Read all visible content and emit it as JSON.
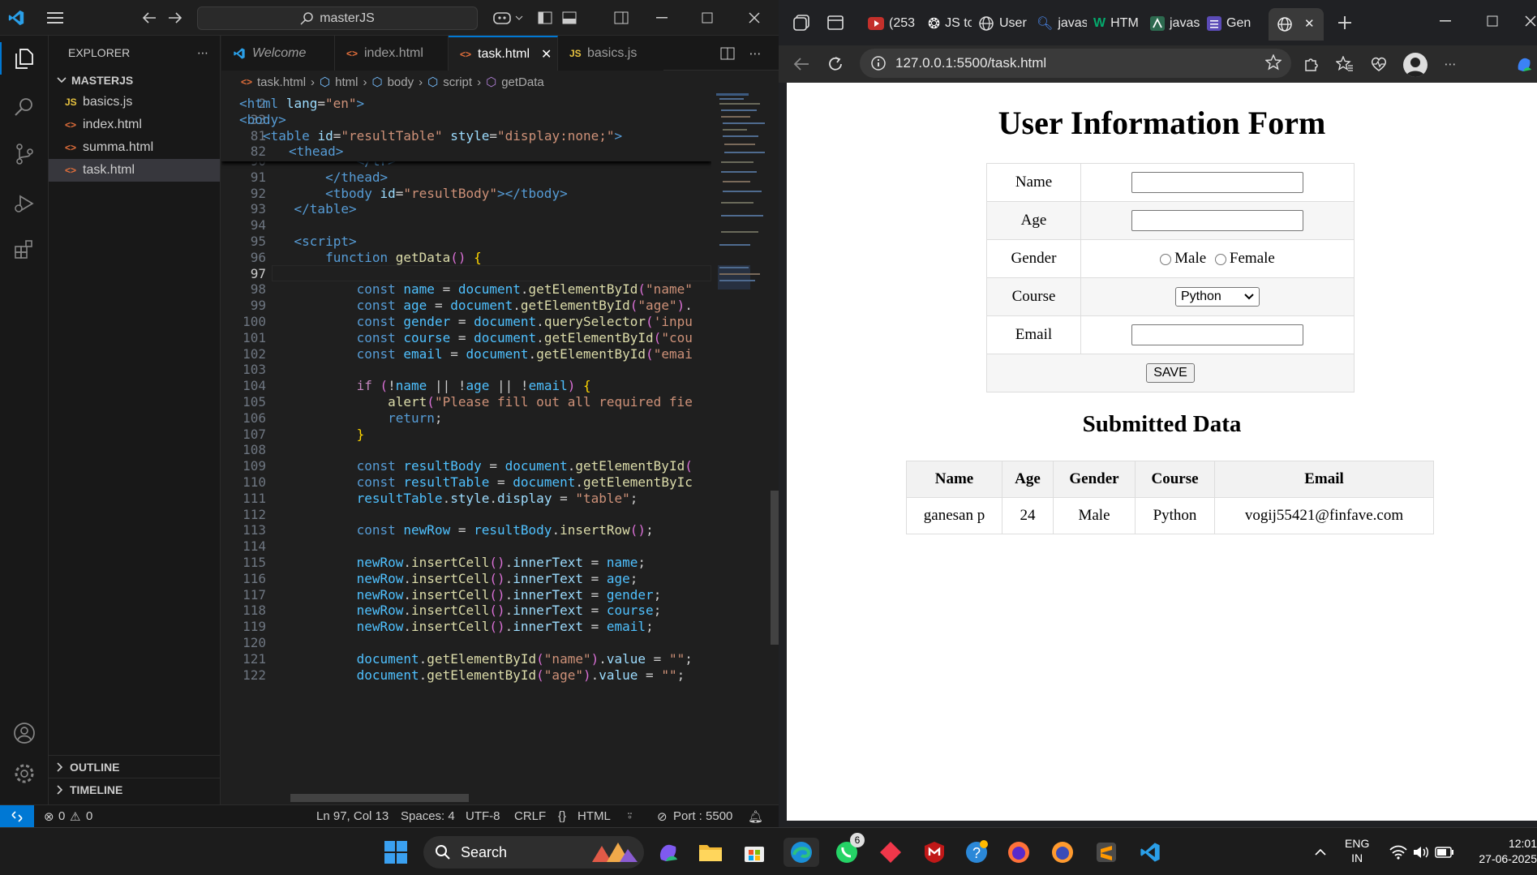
{
  "vscode": {
    "search_text": "masterJS",
    "explorer_title": "EXPLORER",
    "folder": "MASTERJS",
    "files": [
      {
        "name": "basics.js",
        "type": "js"
      },
      {
        "name": "index.html",
        "type": "html"
      },
      {
        "name": "summa.html",
        "type": "html"
      },
      {
        "name": "task.html",
        "type": "html"
      }
    ],
    "outline": "OUTLINE",
    "timeline": "TIMELINE",
    "tabs": [
      {
        "label": "Welcome"
      },
      {
        "label": "index.html"
      },
      {
        "label": "task.html"
      },
      {
        "label": "basics.js"
      }
    ],
    "breadcrumb": [
      "task.html",
      "html",
      "body",
      "script",
      "getData"
    ],
    "sticky_lines": [
      {
        "n": "2",
        "code": "<html lang=\"en\">"
      },
      {
        "n": "33",
        "code": "<body>"
      },
      {
        "n": "81",
        "code": "<table id=\"resultTable\" style=\"display:none;\">"
      },
      {
        "n": "82",
        "code": "<thead>"
      }
    ],
    "code_lines": [
      {
        "n": "90",
        "code": "            </tr>"
      },
      {
        "n": "91",
        "code": "        </thead>"
      },
      {
        "n": "92",
        "code": "        <tbody id=\"resultBody\"></tbody>"
      },
      {
        "n": "93",
        "code": "    </table>"
      },
      {
        "n": "94",
        "code": ""
      },
      {
        "n": "95",
        "code": "    <script>"
      },
      {
        "n": "96",
        "code": "        function getData() {"
      },
      {
        "n": "97",
        "code": ""
      },
      {
        "n": "98",
        "code": "            const name = document.getElementById(\"name\""
      },
      {
        "n": "99",
        "code": "            const age = document.getElementById(\"age\")."
      },
      {
        "n": "100",
        "code": "            const gender = document.querySelector('inpu"
      },
      {
        "n": "101",
        "code": "            const course = document.getElementById(\"cou"
      },
      {
        "n": "102",
        "code": "            const email = document.getElementById(\"emai"
      },
      {
        "n": "103",
        "code": ""
      },
      {
        "n": "104",
        "code": "            if (!name || !age || !email) {"
      },
      {
        "n": "105",
        "code": "                alert(\"Please fill out all required fie"
      },
      {
        "n": "106",
        "code": "                return;"
      },
      {
        "n": "107",
        "code": "            }"
      },
      {
        "n": "108",
        "code": ""
      },
      {
        "n": "109",
        "code": "            const resultBody = document.getElementById("
      },
      {
        "n": "110",
        "code": "            const resultTable = document.getElementByIc"
      },
      {
        "n": "111",
        "code": "            resultTable.style.display = \"table\";"
      },
      {
        "n": "112",
        "code": ""
      },
      {
        "n": "113",
        "code": "            const newRow = resultBody.insertRow();"
      },
      {
        "n": "114",
        "code": ""
      },
      {
        "n": "115",
        "code": "            newRow.insertCell().innerText = name;"
      },
      {
        "n": "116",
        "code": "            newRow.insertCell().innerText = age;"
      },
      {
        "n": "117",
        "code": "            newRow.insertCell().innerText = gender;"
      },
      {
        "n": "118",
        "code": "            newRow.insertCell().innerText = course;"
      },
      {
        "n": "119",
        "code": "            newRow.insertCell().innerText = email;"
      },
      {
        "n": "120",
        "code": ""
      },
      {
        "n": "121",
        "code": "            document.getElementById(\"name\").value = \"\";"
      },
      {
        "n": "122",
        "code": "            document.getElementById(\"age\").value = \"\";"
      }
    ],
    "status": {
      "errors": "0",
      "warnings": "0",
      "position": "Ln 97, Col 13",
      "spaces": "Spaces: 4",
      "encoding": "UTF-8",
      "eol": "CRLF",
      "language": "HTML",
      "port": "Port : 5500"
    }
  },
  "browser": {
    "tabs": [
      "(253",
      "JS to",
      "User",
      "javas",
      "HTM",
      "javas",
      "Gen"
    ],
    "url": "127.0.0.1:5500/task.html",
    "page": {
      "title": "User Information Form",
      "labels": {
        "name": "Name",
        "age": "Age",
        "gender": "Gender",
        "course": "Course",
        "email": "Email"
      },
      "gender_options": [
        "Male",
        "Female"
      ],
      "course_selected": "Python",
      "save": "SAVE",
      "submitted_title": "Submitted Data",
      "columns": [
        "Name",
        "Age",
        "Gender",
        "Course",
        "Email"
      ],
      "rows": [
        [
          "ganesan p",
          "24",
          "Male",
          "Python",
          "vogij55421@finfave.com"
        ]
      ]
    }
  },
  "taskbar": {
    "search": "Search",
    "whatsapp_badge": "6",
    "lang1": "ENG",
    "lang2": "IN",
    "time": "12:01",
    "date": "27-06-2025"
  }
}
